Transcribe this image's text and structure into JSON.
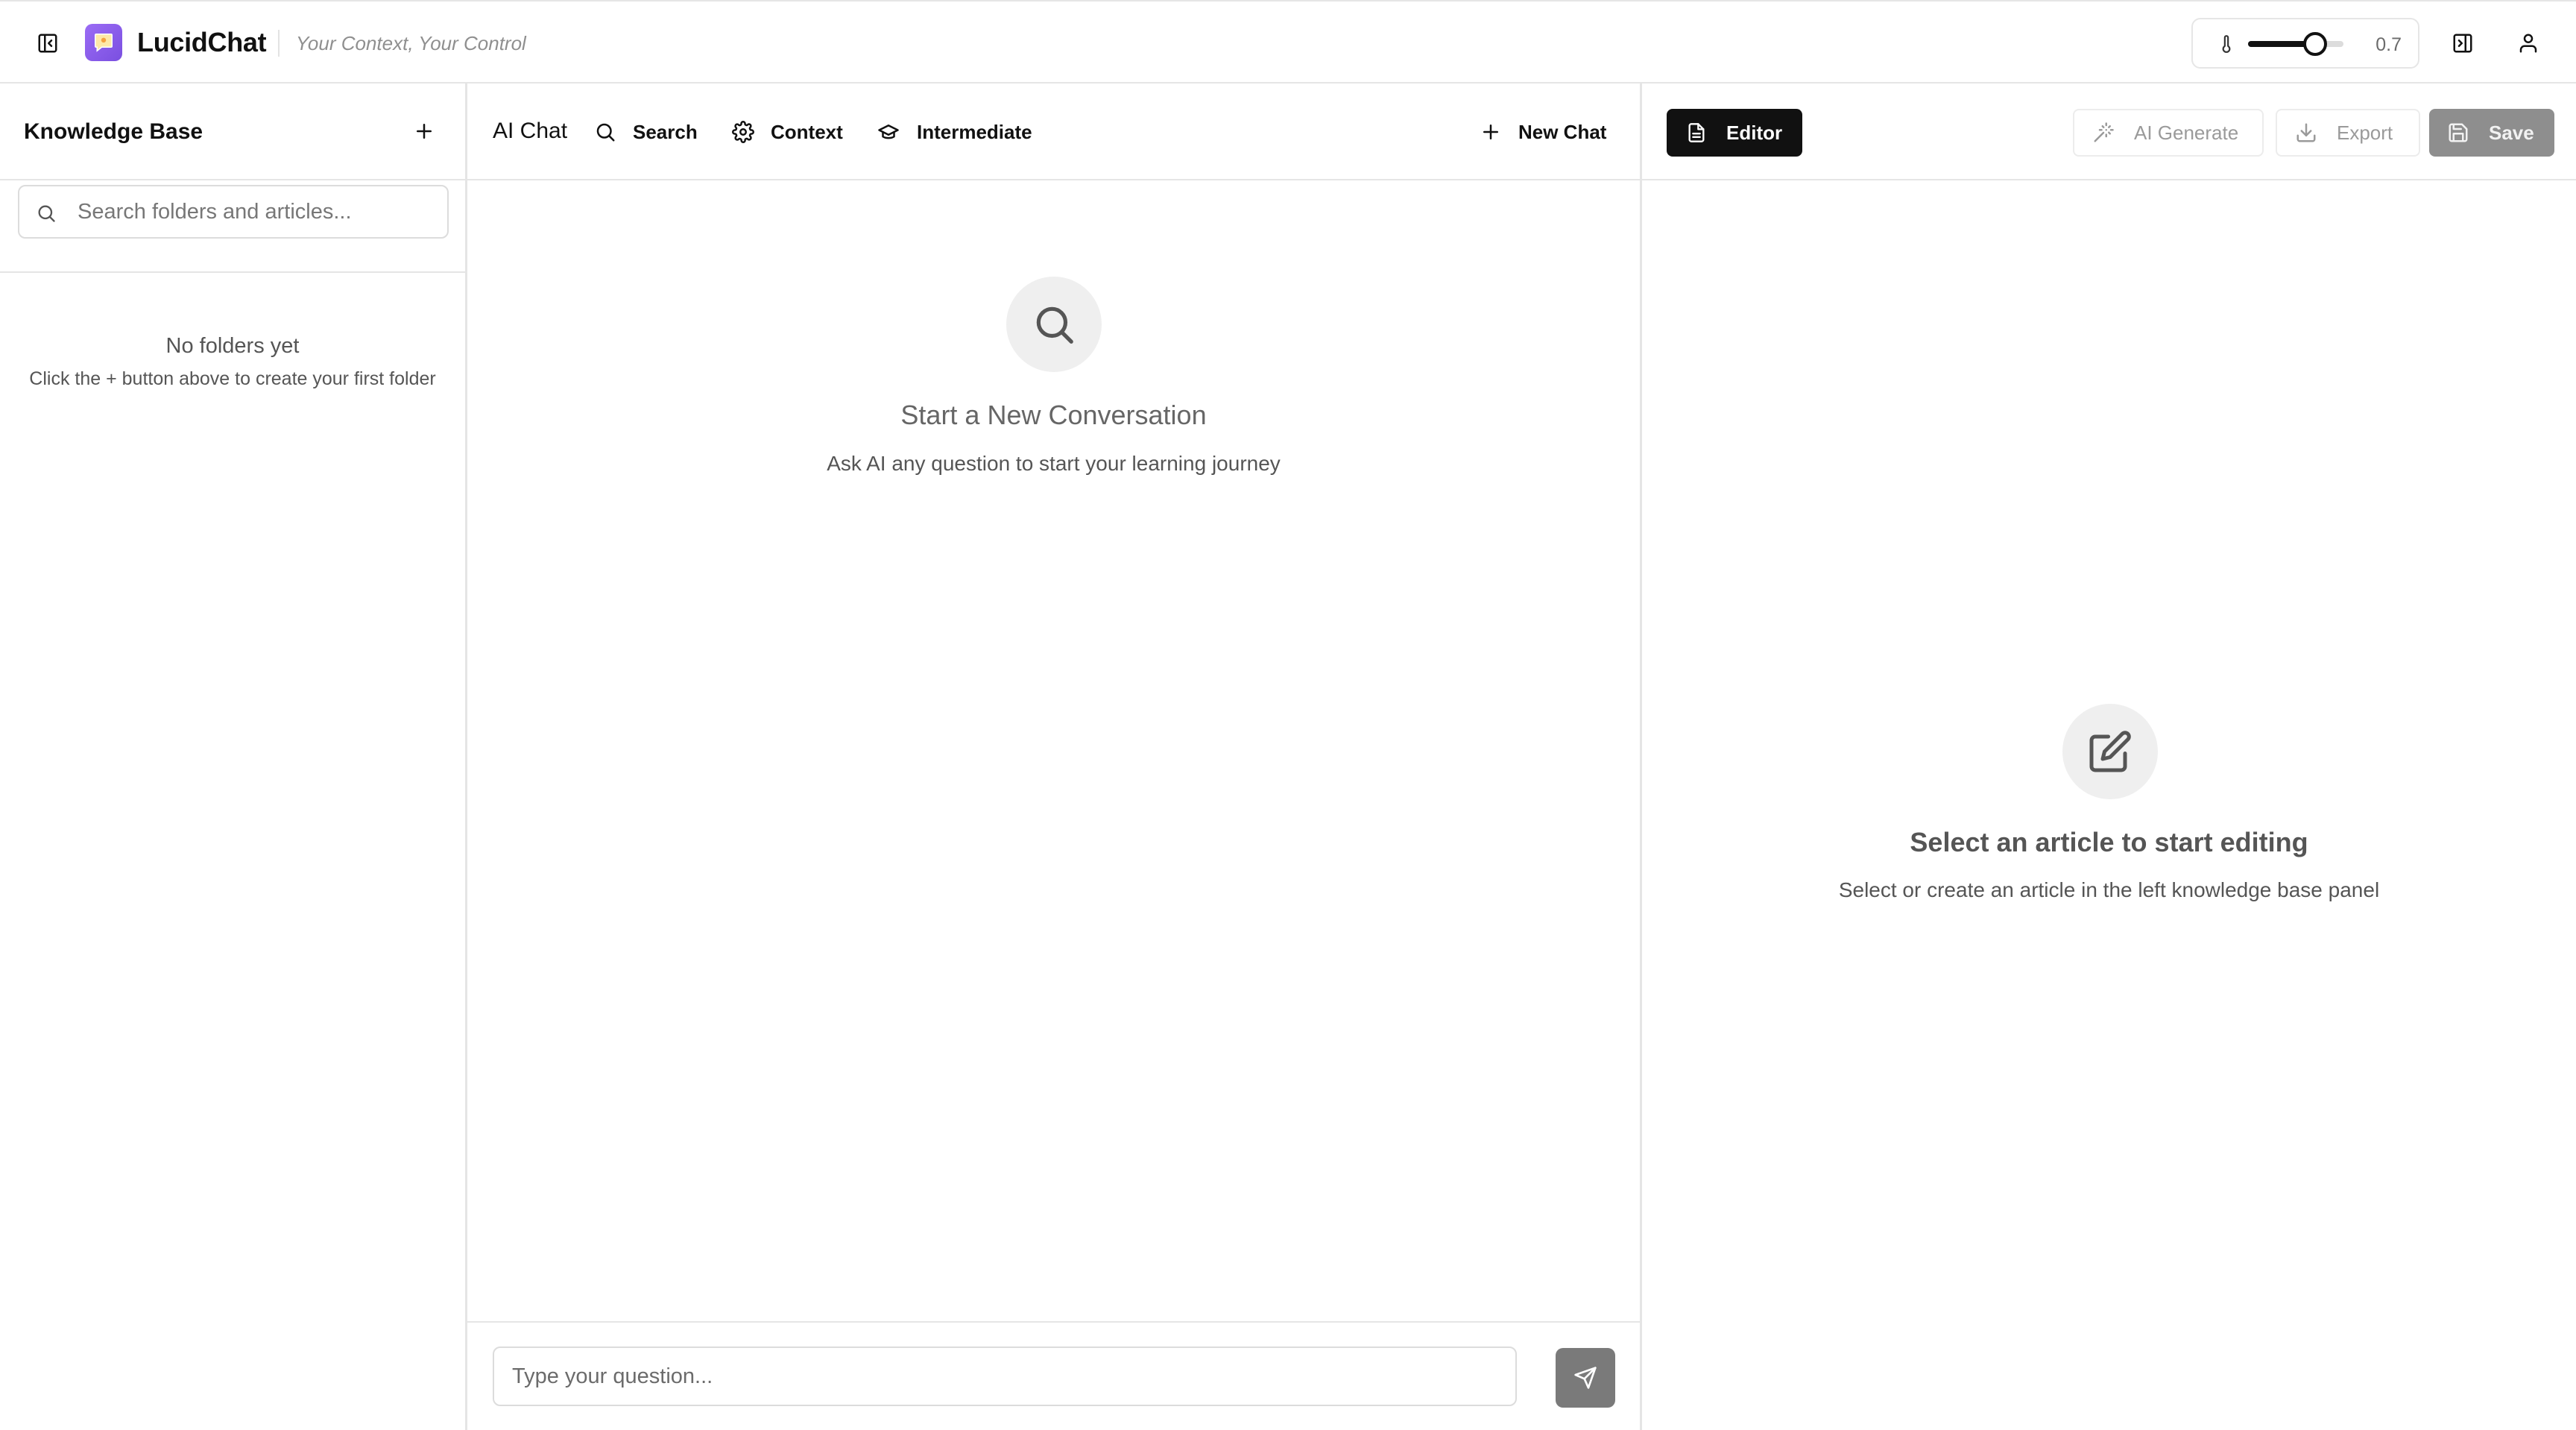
{
  "header": {
    "app_name": "LucidChat",
    "tagline": "Your Context, Your Control",
    "temperature": {
      "value_label": "0.7",
      "level": 0.7
    }
  },
  "knowledge_base": {
    "title": "Knowledge Base",
    "search_placeholder": "Search folders and articles...",
    "empty_title": "No folders yet",
    "empty_subtitle": "Click the + button above to create your first folder"
  },
  "chat": {
    "title": "AI Chat",
    "tools": {
      "search": "Search",
      "context": "Context",
      "level": "Intermediate"
    },
    "new_chat": "New Chat",
    "empty_title": "Start a New Conversation",
    "empty_subtitle": "Ask AI any question to start your learning journey",
    "input_placeholder": "Type your question..."
  },
  "editor": {
    "tab_label": "Editor",
    "ai_generate": "AI Generate",
    "export": "Export",
    "save": "Save",
    "empty_title": "Select an article to start editing",
    "empty_subtitle": "Select or create an article in the left knowledge base panel"
  },
  "colors": {
    "accent": "#111111",
    "logo": "#8b5cf6",
    "border": "#e5e5e5",
    "disabled": "#8e8e8e"
  },
  "icons": [
    "sidebar-toggle-icon",
    "chat-bubble-logo-icon",
    "thermometer-icon",
    "panel-toggle-icon",
    "user-icon",
    "plus-icon",
    "search-icon",
    "gear-icon",
    "graduation-cap-icon",
    "send-icon",
    "document-icon",
    "magic-wand-icon",
    "download-icon",
    "save-icon",
    "edit-icon"
  ]
}
